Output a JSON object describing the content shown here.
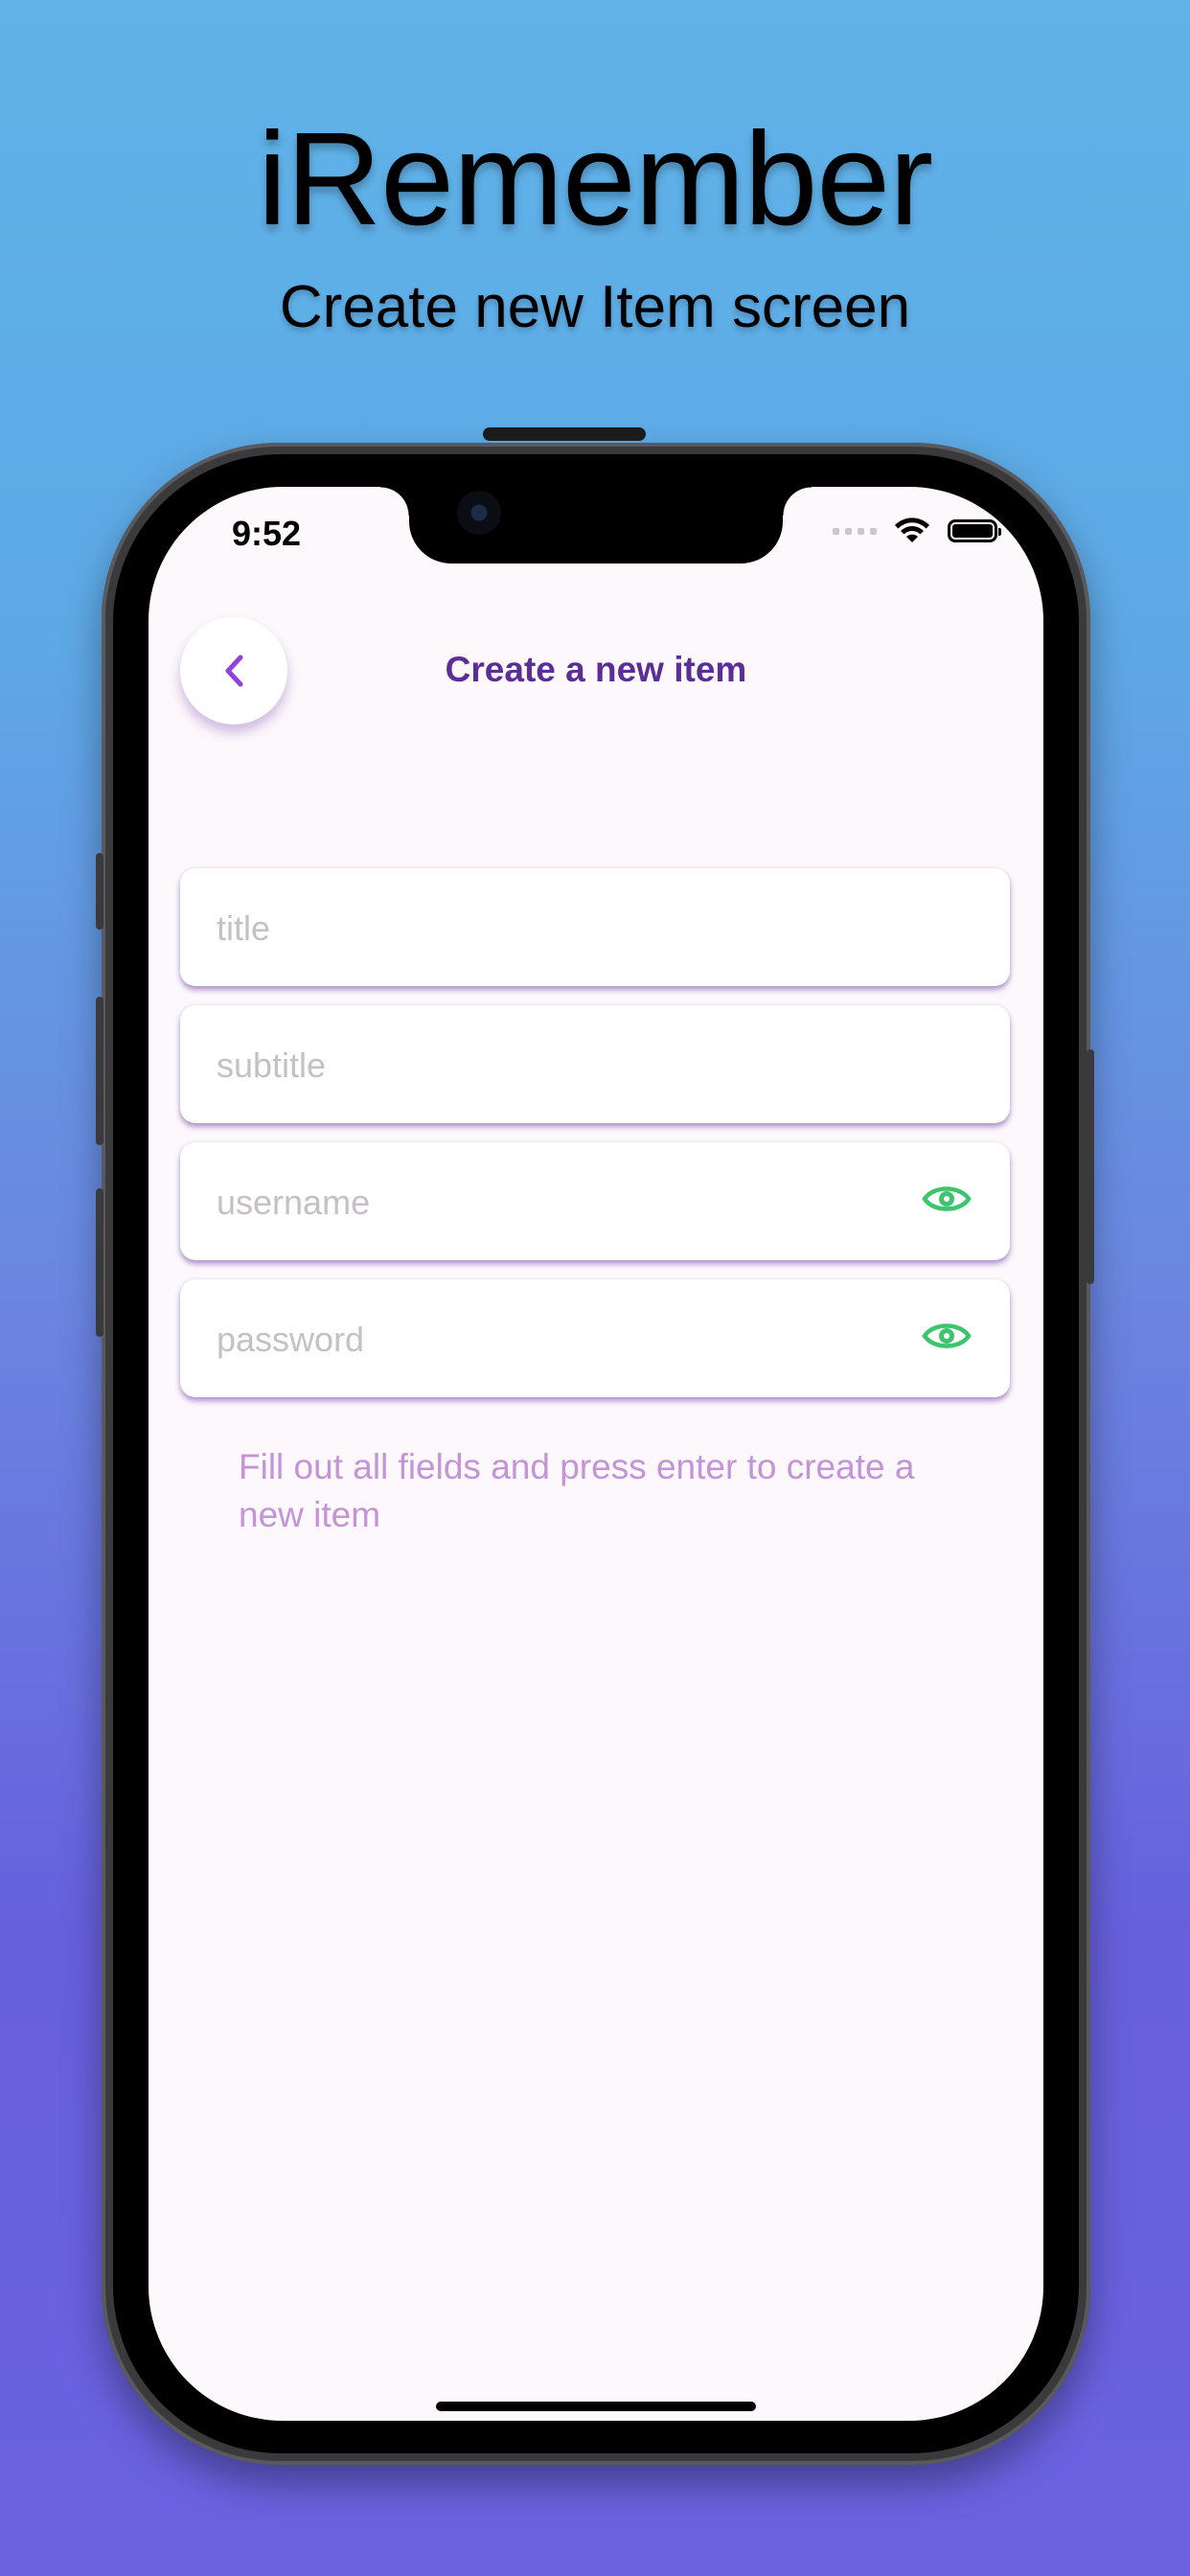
{
  "promo": {
    "title": "iRemember",
    "subtitle": "Create new Item screen"
  },
  "status_bar": {
    "time": "9:52",
    "icons": [
      "cellular-signal-icon",
      "wifi-icon",
      "battery-icon"
    ]
  },
  "header": {
    "back_icon": "chevron-left-icon",
    "title": "Create a new item"
  },
  "form": {
    "fields": [
      {
        "placeholder": "title",
        "value": ""
      },
      {
        "placeholder": "subtitle",
        "value": ""
      },
      {
        "placeholder": "username",
        "value": "",
        "toggle_icon": "eye-icon"
      },
      {
        "placeholder": "password",
        "value": "",
        "toggle_icon": "eye-icon"
      }
    ],
    "hint": "Fill out all fields and press enter to create a new item"
  },
  "colors": {
    "accent": "#8e44d8",
    "title_text": "#5a2d97",
    "hint_text": "#c493d8",
    "eye_icon": "#3cc46e",
    "screen_bg": "#fcf8fc"
  }
}
